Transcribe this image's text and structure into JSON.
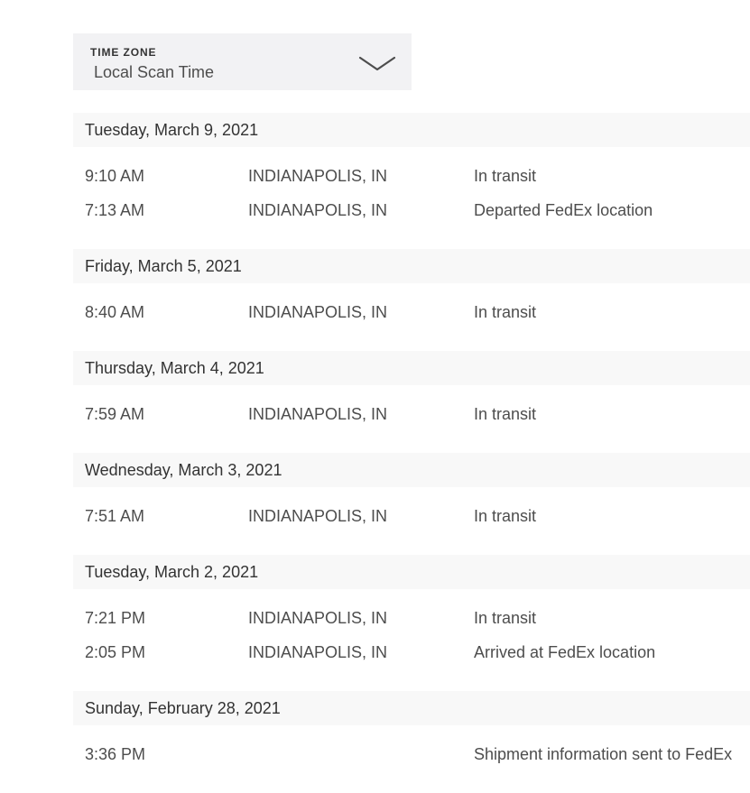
{
  "timezone": {
    "label": "TIME ZONE",
    "value": "Local Scan Time"
  },
  "days": [
    {
      "date": "Tuesday, March 9, 2021",
      "events": [
        {
          "time": "9:10 AM",
          "location": "INDIANAPOLIS, IN",
          "status": "In transit"
        },
        {
          "time": "7:13 AM",
          "location": "INDIANAPOLIS, IN",
          "status": "Departed FedEx location"
        }
      ]
    },
    {
      "date": "Friday, March 5, 2021",
      "events": [
        {
          "time": "8:40 AM",
          "location": "INDIANAPOLIS, IN",
          "status": "In transit"
        }
      ]
    },
    {
      "date": "Thursday, March 4, 2021",
      "events": [
        {
          "time": "7:59 AM",
          "location": "INDIANAPOLIS, IN",
          "status": "In transit"
        }
      ]
    },
    {
      "date": "Wednesday, March 3, 2021",
      "events": [
        {
          "time": "7:51 AM",
          "location": "INDIANAPOLIS, IN",
          "status": "In transit"
        }
      ]
    },
    {
      "date": "Tuesday, March 2, 2021",
      "events": [
        {
          "time": "7:21 PM",
          "location": "INDIANAPOLIS, IN",
          "status": "In transit"
        },
        {
          "time": "2:05 PM",
          "location": "INDIANAPOLIS, IN",
          "status": "Arrived at FedEx location"
        }
      ]
    },
    {
      "date": "Sunday, February 28, 2021",
      "events": [
        {
          "time": "3:36 PM",
          "location": "",
          "status": "Shipment information sent to FedEx"
        }
      ]
    }
  ],
  "colors": {
    "dropdown_bg": "#f2f2f4",
    "day_header_bg": "#f8f8f8",
    "text": "#333333"
  },
  "icons": {
    "dropdown": "chevron-down-icon"
  }
}
